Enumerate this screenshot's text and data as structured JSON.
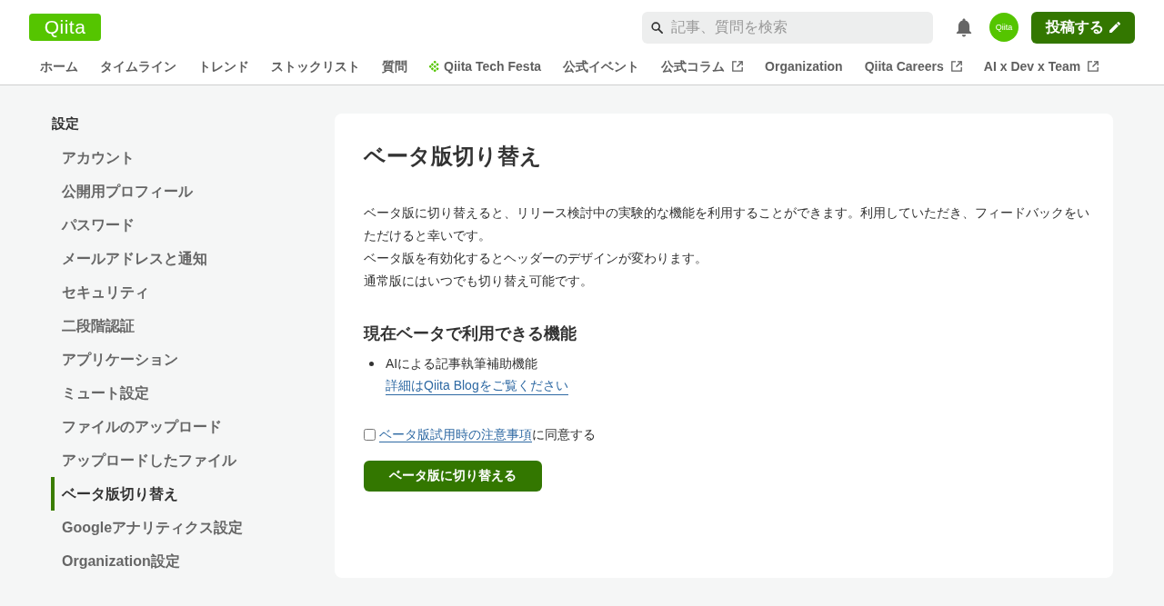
{
  "header": {
    "logo": "Qiita",
    "search": {
      "placeholder": "記事、質問を検索"
    },
    "avatar": "Qiita",
    "post_button": "投稿する"
  },
  "nav": [
    {
      "label": "ホーム",
      "kind": "plain"
    },
    {
      "label": "タイムライン",
      "kind": "plain"
    },
    {
      "label": "トレンド",
      "kind": "plain"
    },
    {
      "label": "ストックリスト",
      "kind": "plain"
    },
    {
      "label": "質問",
      "kind": "plain"
    },
    {
      "label": "Qiita Tech Festa",
      "kind": "event"
    },
    {
      "label": "公式イベント",
      "kind": "plain"
    },
    {
      "label": "公式コラム",
      "kind": "external"
    },
    {
      "label": "Organization",
      "kind": "plain"
    },
    {
      "label": "Qiita Careers",
      "kind": "external"
    },
    {
      "label": "AI x Dev x Team",
      "kind": "external"
    }
  ],
  "sidebar": {
    "title": "設定",
    "items": [
      {
        "label": "アカウント",
        "selected": false
      },
      {
        "label": "公開用プロフィール",
        "selected": false
      },
      {
        "label": "パスワード",
        "selected": false
      },
      {
        "label": "メールアドレスと通知",
        "selected": false
      },
      {
        "label": "セキュリティ",
        "selected": false
      },
      {
        "label": "二段階認証",
        "selected": false
      },
      {
        "label": "アプリケーション",
        "selected": false
      },
      {
        "label": "ミュート設定",
        "selected": false
      },
      {
        "label": "ファイルのアップロード",
        "selected": false
      },
      {
        "label": "アップロードしたファイル",
        "selected": false
      },
      {
        "label": "ベータ版切り替え",
        "selected": true
      },
      {
        "label": "Googleアナリティクス設定",
        "selected": false
      },
      {
        "label": "Organization設定",
        "selected": false
      }
    ]
  },
  "main": {
    "title": "ベータ版切り替え",
    "paragraphs": [
      "ベータ版に切り替えると、リリース検討中の実験的な機能を利用することができます。利用していただき、フィードバックをいただけると幸いです。",
      "ベータ版を有効化するとヘッダーのデザインが変わります。",
      "通常版にはいつでも切り替え可能です。"
    ],
    "features_heading": "現在ベータで利用できる機能",
    "features": [
      {
        "text": "AIによる記事執筆補助機能",
        "link": "詳細はQiita Blogをご覧ください"
      }
    ],
    "agreement": {
      "checked": false,
      "link": "ベータ版試用時の注意事項",
      "text": "に同意する"
    },
    "submit_button": "ベータ版に切り替える"
  }
}
